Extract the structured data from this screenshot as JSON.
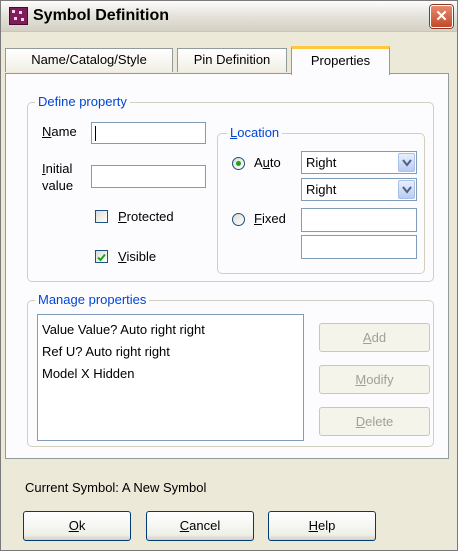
{
  "window": {
    "title": "Symbol Definition",
    "close_glyph": "✕",
    "icon": "symbol-app-icon"
  },
  "tabs": [
    {
      "label": "Name/Catalog/Style",
      "active": false
    },
    {
      "label": "Pin Definition",
      "active": false
    },
    {
      "label": "Properties",
      "active": true
    }
  ],
  "define": {
    "legend": "Define property",
    "name_label": "Name",
    "name_value": "",
    "initial_label_1": "Initial",
    "initial_label_2": "value",
    "initial_value": "",
    "protected_label": "Protected",
    "protected_checked": false,
    "visible_label": "Visible",
    "visible_checked": true,
    "location": {
      "legend": "Location",
      "auto_label": "Auto",
      "auto_selected": true,
      "fixed_label": "Fixed",
      "fixed_selected": false,
      "select1": "Right",
      "select2": "Right",
      "fixed_x": "",
      "fixed_y": ""
    }
  },
  "manage": {
    "legend": "Manage properties",
    "items": [
      "Value Value? Auto right right",
      "Ref U? Auto right right",
      "Model X Hidden"
    ],
    "add_label": "Add",
    "modify_label": "Modify",
    "delete_label": "Delete"
  },
  "status": {
    "text": "Current Symbol: A New Symbol"
  },
  "buttons": {
    "ok": "Ok",
    "cancel": "Cancel",
    "help": "Help"
  },
  "colors": {
    "accent": "#0046D5",
    "tab_highlight": "#FFC83C",
    "window_bg": "#ECE9D8",
    "close_button": "#C2482A",
    "radio_dot": "#21A121"
  }
}
